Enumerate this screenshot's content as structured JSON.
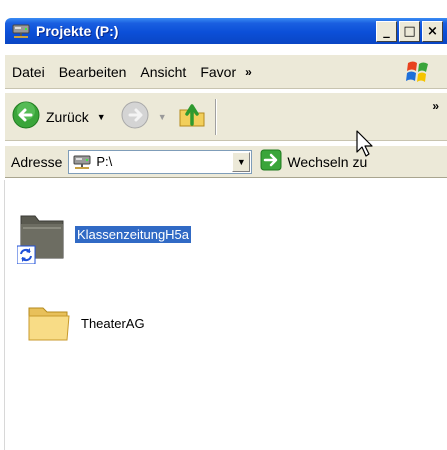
{
  "window": {
    "title": "Projekte (P:)",
    "buttons": {
      "minimize": "_",
      "maximize": "□",
      "close": "×"
    }
  },
  "menu": {
    "items": [
      "Datei",
      "Bearbeiten",
      "Ansicht",
      "Favor"
    ],
    "overflow": "»"
  },
  "toolbar": {
    "back_label": "Zurück",
    "overflow": "»"
  },
  "address": {
    "label": "Adresse",
    "value": "P:\\",
    "go_label": "Wechseln zu"
  },
  "files": [
    {
      "name": "KlassenzeitungH5a",
      "type": "shared-folder",
      "selected": true
    },
    {
      "name": "TheaterAG",
      "type": "folder",
      "selected": false
    }
  ],
  "colors": {
    "titlebar": "#0b4fd8",
    "chrome": "#ece9d8",
    "selection": "#316ac5"
  }
}
